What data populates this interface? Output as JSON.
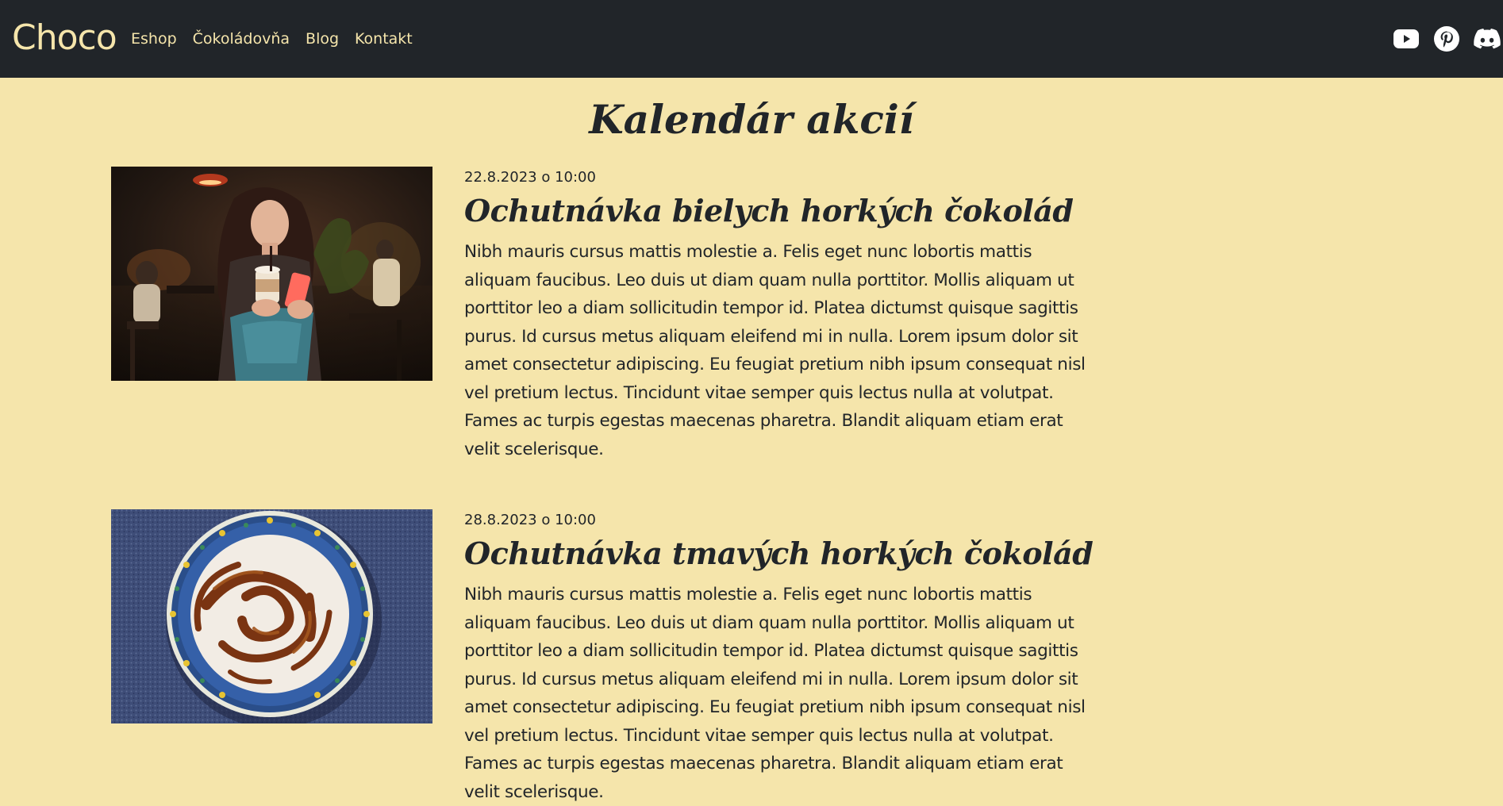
{
  "nav": {
    "brand": "Choco",
    "links": [
      "Eshop",
      "Čokoládovňa",
      "Blog",
      "Kontakt"
    ],
    "socials": [
      "youtube-icon",
      "pinterest-icon",
      "discord-icon"
    ]
  },
  "page": {
    "title": "Kalendár akcií"
  },
  "events": [
    {
      "date": "22.8.2023 o 10:00",
      "title": "Ochutnávka bielych horkých čokolád",
      "text": "Nibh mauris cursus mattis molestie a. Felis eget nunc lobortis mattis aliquam faucibus. Leo duis ut diam quam nulla porttitor. Mollis aliquam ut porttitor leo a diam sollicitudin tempor id. Platea dictumst quisque sagittis purus. Id cursus metus aliquam eleifend mi in nulla. Lorem ipsum dolor sit amet consectetur adipiscing. Eu feugiat pretium nibh ipsum consequat nisl vel pretium lectus. Tincidunt vitae semper quis lectus nulla at volutpat. Fames ac turpis egestas maecenas pharetra. Blandit aliquam etiam erat velit scelerisque."
    },
    {
      "date": "28.8.2023 o 10:00",
      "title": "Ochutnávka tmavých horkých čokolád",
      "text": "Nibh mauris cursus mattis molestie a. Felis eget nunc lobortis mattis aliquam faucibus. Leo duis ut diam quam nulla porttitor. Mollis aliquam ut porttitor leo a diam sollicitudin tempor id. Platea dictumst quisque sagittis purus. Id cursus metus aliquam eleifend mi in nulla. Lorem ipsum dolor sit amet consectetur adipiscing. Eu feugiat pretium nibh ipsum consequat nisl vel pretium lectus. Tincidunt vitae semper quis lectus nulla at volutpat. Fames ac turpis egestas maecenas pharetra. Blandit aliquam etiam erat velit scelerisque."
    }
  ],
  "colors": {
    "navbar": "#212529",
    "background": "#f5e5ab",
    "accent": "#f5e5ab",
    "text": "#212529"
  }
}
